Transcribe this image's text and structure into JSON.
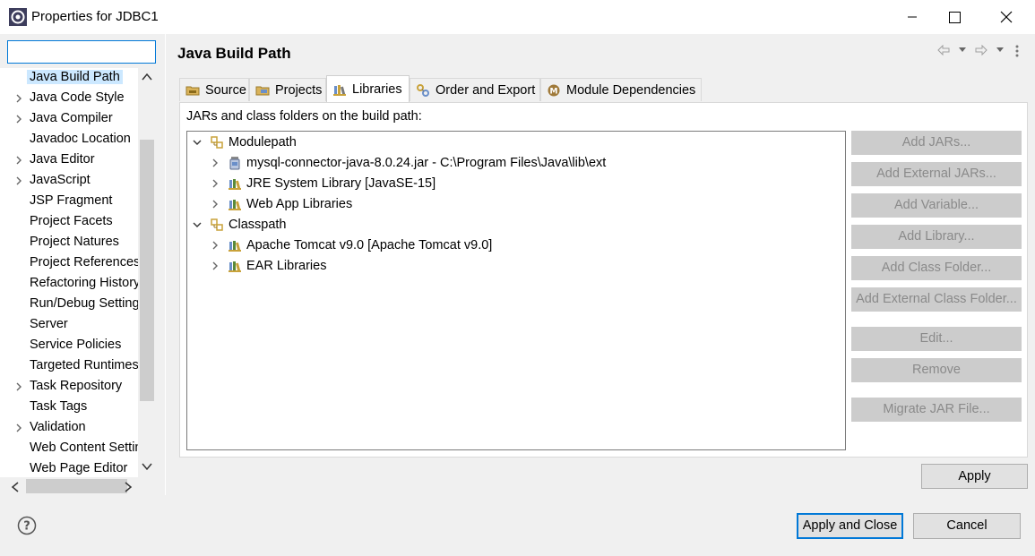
{
  "window": {
    "title": "Properties for JDBC1",
    "minimize_icon": "minimize-icon",
    "maximize_icon": "maximize-icon",
    "close_icon": "close-icon"
  },
  "sidebar": {
    "filter_value": "",
    "items": [
      {
        "label": "Java Build Path",
        "expandable": false,
        "selected": true
      },
      {
        "label": "Java Code Style",
        "expandable": true
      },
      {
        "label": "Java Compiler",
        "expandable": true
      },
      {
        "label": "Javadoc Location",
        "expandable": false
      },
      {
        "label": "Java Editor",
        "expandable": true
      },
      {
        "label": "JavaScript",
        "expandable": true
      },
      {
        "label": "JSP Fragment",
        "expandable": false
      },
      {
        "label": "Project Facets",
        "expandable": false
      },
      {
        "label": "Project Natures",
        "expandable": false
      },
      {
        "label": "Project References",
        "expandable": false
      },
      {
        "label": "Refactoring History",
        "expandable": false
      },
      {
        "label": "Run/Debug Settings",
        "expandable": false
      },
      {
        "label": "Server",
        "expandable": false
      },
      {
        "label": "Service Policies",
        "expandable": false
      },
      {
        "label": "Targeted Runtimes",
        "expandable": false
      },
      {
        "label": "Task Repository",
        "expandable": true
      },
      {
        "label": "Task Tags",
        "expandable": false
      },
      {
        "label": "Validation",
        "expandable": true
      },
      {
        "label": "Web Content Settings",
        "expandable": false
      },
      {
        "label": "Web Page Editor",
        "expandable": false
      }
    ]
  },
  "main": {
    "title": "Java Build Path",
    "tabs": [
      {
        "label": "Source",
        "icon": "source-folder-icon"
      },
      {
        "label": "Projects",
        "icon": "projects-icon"
      },
      {
        "label": "Libraries",
        "icon": "libraries-icon",
        "active": true
      },
      {
        "label": "Order and Export",
        "icon": "order-export-icon"
      },
      {
        "label": "Module Dependencies",
        "icon": "module-icon"
      }
    ],
    "build_path_label": "JARs and class folders on the build path:",
    "tree": [
      {
        "label": "Modulepath",
        "level": 0,
        "expanded": true,
        "icon": "modulepath-icon"
      },
      {
        "label": "mysql-connector-java-8.0.24.jar - C:\\Program Files\\Java\\lib\\ext",
        "level": 1,
        "icon": "jar-icon"
      },
      {
        "label": "JRE System Library [JavaSE-15]",
        "level": 1,
        "icon": "library-icon"
      },
      {
        "label": "Web App Libraries",
        "level": 1,
        "icon": "library-icon"
      },
      {
        "label": "Classpath",
        "level": 0,
        "expanded": true,
        "icon": "classpath-icon"
      },
      {
        "label": "Apache Tomcat v9.0 [Apache Tomcat v9.0]",
        "level": 1,
        "icon": "library-icon"
      },
      {
        "label": "EAR Libraries",
        "level": 1,
        "icon": "library-icon"
      }
    ],
    "buttons": {
      "add_jars": "Add JARs...",
      "add_external_jars": "Add External JARs...",
      "add_variable": "Add Variable...",
      "add_library": "Add Library...",
      "add_class_folder": "Add Class Folder...",
      "add_external_class_folder": "Add External Class Folder...",
      "edit": "Edit...",
      "remove": "Remove",
      "migrate_jar": "Migrate JAR File..."
    },
    "apply": "Apply"
  },
  "footer": {
    "apply_close": "Apply and Close",
    "cancel": "Cancel"
  },
  "colors": {
    "accent": "#0078d7",
    "selection": "#cce8ff",
    "disabled_button": "#cccccc"
  }
}
